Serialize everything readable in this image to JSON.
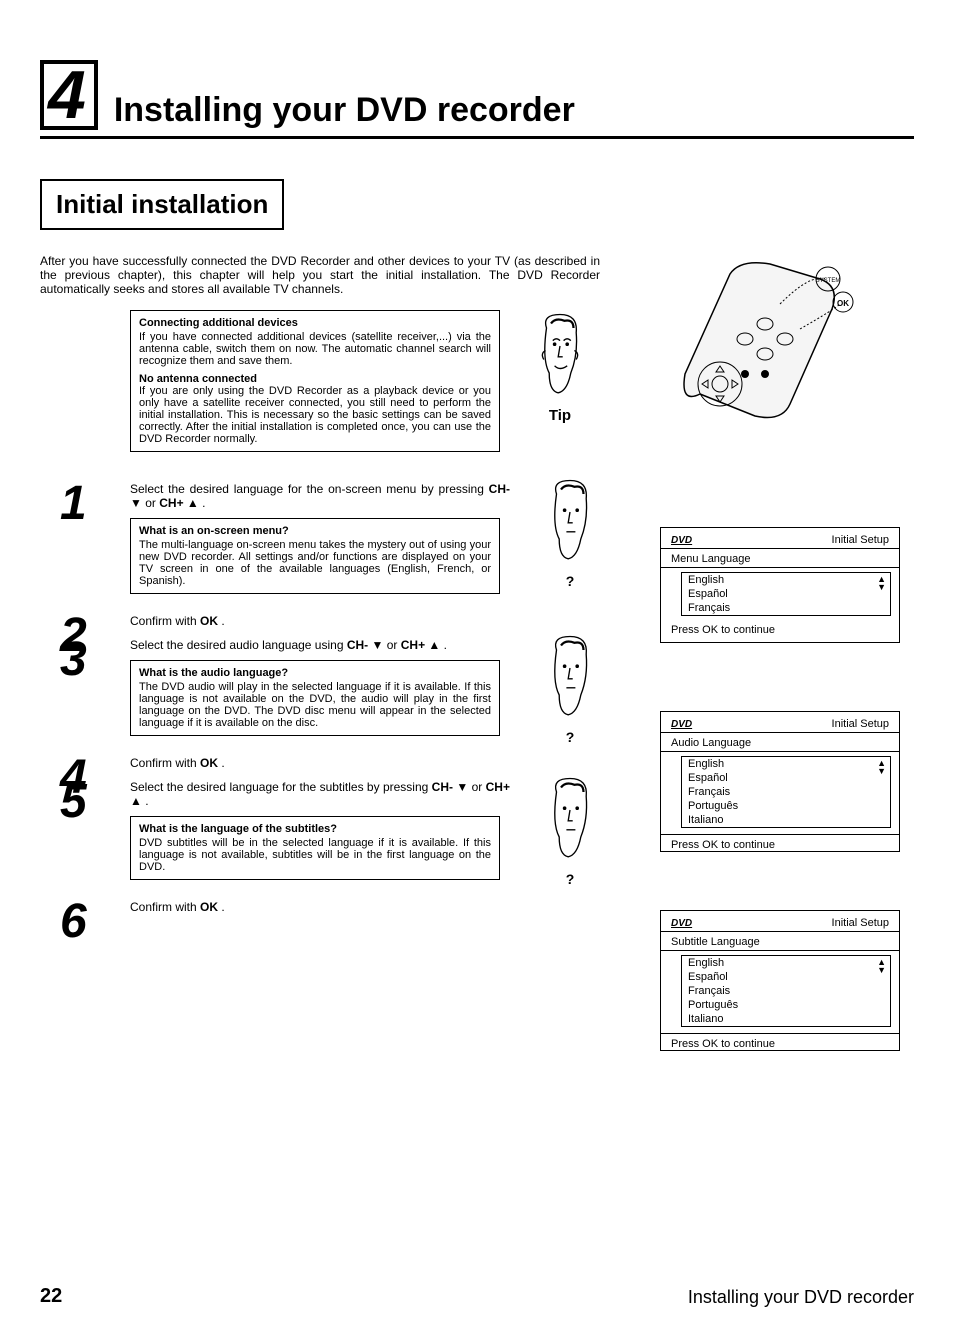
{
  "chapter": {
    "number": "4",
    "title": "Installing your DVD recorder"
  },
  "section_title": "Initial installation",
  "intro": "After you have successfully connected the DVD Recorder and other devices to your TV (as described in the previous chapter), this chapter will help you start the initial installation. The DVD Recorder automatically seeks and stores all available TV channels.",
  "note1": {
    "title1": "Connecting additional devices",
    "body1": "If you have connected additional devices (satellite receiver,...) via the antenna cable, switch them on now. The automatic channel search will recognize them and save them.",
    "title2": "No antenna connected",
    "body2": "If you are only using the DVD Recorder as a playback device or you only have a satellite receiver connected, you still need to perform the initial installation. This is necessary so the basic settings can be saved correctly. After the initial installation is completed once, you can use the DVD Recorder normally."
  },
  "tip_label": "Tip",
  "steps": {
    "s1": {
      "num": "1",
      "text_a": "Select the desired language for the on-screen menu by pressing ",
      "ch_minus": "CH-",
      "or": " or ",
      "ch_plus": "CH+",
      "dot": " ."
    },
    "s1_note": {
      "title": "What is an on-screen menu?",
      "body": "The multi-language on-screen menu takes the mystery out of using your new DVD recorder. All settings and/or functions are displayed on your TV screen in one of the available languages (English, French, or Spanish)."
    },
    "s2": {
      "num": "2",
      "text": "Confirm with ",
      "ok": "OK",
      "dot": " ."
    },
    "s3": {
      "num": "3",
      "text": "Select the desired audio language using ",
      "ch_minus": "CH-",
      "or": " or ",
      "ch_plus": "CH+",
      "dot": " ."
    },
    "s3_note": {
      "title": "What is the audio language?",
      "body": "The DVD audio will play in the selected language if it is available. If this language is not available on the DVD, the audio will play in the first language on the DVD. The DVD disc menu will appear in the selected language if it is available on the disc."
    },
    "s4": {
      "num": "4",
      "text": "Confirm with ",
      "ok": "OK",
      "dot": " ."
    },
    "s5": {
      "num": "5",
      "text": "Select the desired language for the subtitles by pressing ",
      "ch_minus": "CH-",
      "or": " or ",
      "ch_plus": "CH+",
      "dot": " ."
    },
    "s5_note": {
      "title": "What is the language of the subtitles?",
      "body": "DVD subtitles will be in the selected language if it is available. If this language is not available, subtitles will be in the first language on the DVD."
    },
    "s6": {
      "num": "6",
      "text": "Confirm with ",
      "ok": "OK",
      "dot": " ."
    }
  },
  "question_mark": "?",
  "osd": {
    "logo": "DVD",
    "header_right": "Initial Setup",
    "menu1": {
      "section": "Menu Language",
      "options": [
        "English",
        "Español",
        "Français"
      ],
      "footer": "Press OK to continue"
    },
    "menu2": {
      "section": "Audio Language",
      "options": [
        "English",
        "Español",
        "Français",
        "Português",
        "Italiano"
      ],
      "footer": "Press OK to continue"
    },
    "menu3": {
      "section": "Subtitle Language",
      "options": [
        "English",
        "Español",
        "Français",
        "Português",
        "Italiano"
      ],
      "footer": "Press OK to continue"
    }
  },
  "remote": {
    "system_label": "SYSTEM",
    "ok_label": "OK"
  },
  "footer": {
    "page": "22",
    "title": "Installing your DVD recorder"
  }
}
